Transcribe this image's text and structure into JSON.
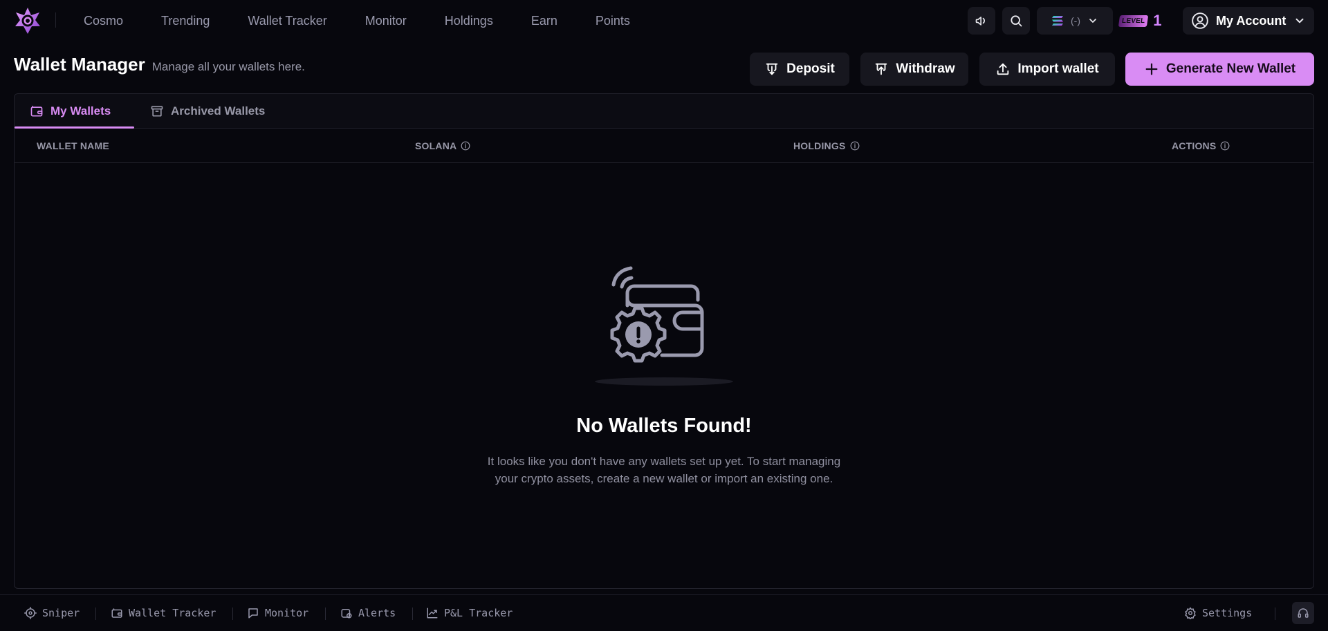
{
  "topbar": {
    "nav": [
      "Cosmo",
      "Trending",
      "Wallet Tracker",
      "Monitor",
      "Holdings",
      "Earn",
      "Points"
    ],
    "chain_value": "(-)",
    "level_tag": "LEVEL",
    "level_number": "1",
    "account_label": "My Account",
    "icons": {
      "logo": "star-logo-icon",
      "announce": "megaphone-icon",
      "search": "search-icon",
      "chain": "solana-icon",
      "chevron": "chevron-down-icon",
      "account": "user-circle-icon"
    }
  },
  "header": {
    "title": "Wallet Manager",
    "subtitle": "Manage all your wallets here.",
    "buttons": {
      "deposit": "Deposit",
      "withdraw": "Withdraw",
      "import": "Import wallet",
      "generate": "Generate New Wallet"
    }
  },
  "tabs": {
    "my_wallets": "My Wallets",
    "archived": "Archived Wallets",
    "active": "my_wallets"
  },
  "table": {
    "columns": [
      "WALLET NAME",
      "SOLANA",
      "HOLDINGS",
      "ACTIONS"
    ]
  },
  "empty_state": {
    "title": "No Wallets Found!",
    "description": "It looks like you don't have any wallets set up yet. To start managing your crypto assets, create a new wallet or import an existing one."
  },
  "bottombar": {
    "items": [
      "Sniper",
      "Wallet Tracker",
      "Monitor",
      "Alerts",
      "P&L Tracker"
    ],
    "settings": "Settings"
  },
  "colors": {
    "background": "#07070d",
    "accent": "#d98cf4",
    "surface": "#17171f",
    "muted_text": "#9898a8"
  }
}
